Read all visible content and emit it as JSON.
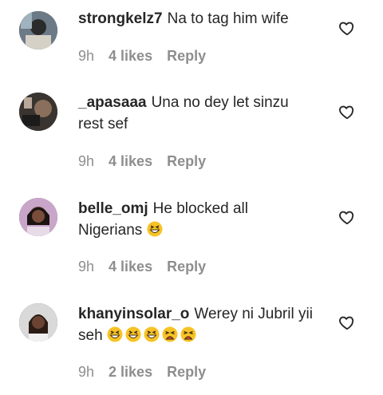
{
  "comments": [
    {
      "username": "strongkelz7",
      "text": "Na to tag him wife",
      "time": "9h",
      "likes": "4 likes",
      "reply": "Reply",
      "emojis": []
    },
    {
      "username": "_apasaaa",
      "text": "Una no dey let sinzu rest sef",
      "time": "9h",
      "likes": "4 likes",
      "reply": "Reply",
      "emojis": []
    },
    {
      "username": "belle_omj",
      "text": "He blocked all Nigerians",
      "time": "9h",
      "likes": "4 likes",
      "reply": "Reply",
      "emojis": [
        "grinning-squinting-face"
      ]
    },
    {
      "username": "khanyinsolar_o",
      "text": "Werey ni Jubril yii seh",
      "time": "9h",
      "likes": "2 likes",
      "reply": "Reply",
      "emojis": [
        "grinning-squinting-face",
        "grinning-squinting-face",
        "grinning-squinting-face",
        "tired-face",
        "tired-face"
      ]
    }
  ],
  "icons": {
    "like": "heart-outline-icon"
  },
  "colors": {
    "text": "#262626",
    "meta": "#8e8e8e",
    "emoji": "#f7c325"
  }
}
